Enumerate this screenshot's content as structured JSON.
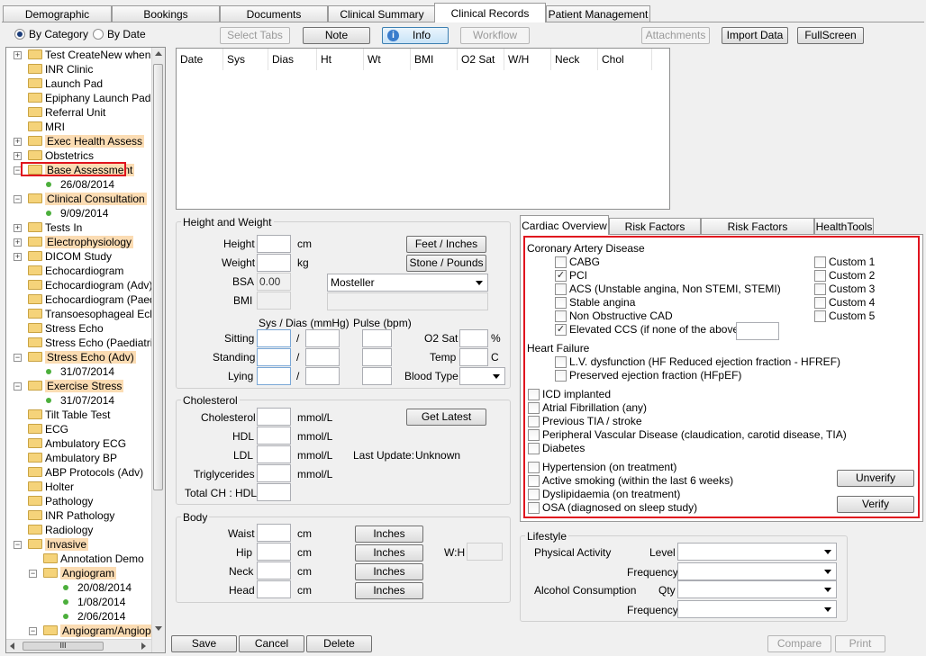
{
  "top_tabs": [
    "Demographic",
    "Bookings",
    "Documents",
    "Clinical Summary",
    "Clinical Records",
    "Patient Management"
  ],
  "view_mode": {
    "by_category": "By Category",
    "by_date": "By Date"
  },
  "toolbar": {
    "select_tabs": "Select Tabs",
    "note": "Note",
    "info": "Info",
    "workflow": "Workflow",
    "attachments": "Attachments",
    "import_data": "Import Data",
    "fullscreen": "FullScreen"
  },
  "tree": [
    {
      "label": "Test CreateNew when di",
      "level": 0,
      "expander": "+",
      "hl": false
    },
    {
      "label": "INR Clinic",
      "level": 0,
      "expander": "",
      "hl": false
    },
    {
      "label": "Launch Pad",
      "level": 0,
      "expander": "",
      "hl": false
    },
    {
      "label": "Epiphany Launch Pad",
      "level": 0,
      "expander": "",
      "hl": false
    },
    {
      "label": "Referral Unit",
      "level": 0,
      "expander": "",
      "hl": false
    },
    {
      "label": "MRI",
      "level": 0,
      "expander": "",
      "hl": false
    },
    {
      "label": "Exec Health Assess",
      "level": 0,
      "expander": "+",
      "hl": true
    },
    {
      "label": "Obstetrics",
      "level": 0,
      "expander": "+",
      "hl": false
    },
    {
      "label": "Base Assessment",
      "level": 0,
      "expander": "-",
      "hl": true,
      "outlined": true
    },
    {
      "label": "26/08/2014",
      "level": 1,
      "date": true
    },
    {
      "label": "Clinical Consultation",
      "level": 0,
      "expander": "-",
      "hl": true
    },
    {
      "label": "9/09/2014",
      "level": 1,
      "date": true
    },
    {
      "label": "Tests In",
      "level": 0,
      "expander": "+",
      "hl": false
    },
    {
      "label": "Electrophysiology",
      "level": 0,
      "expander": "+",
      "hl": true
    },
    {
      "label": "DICOM Study",
      "level": 0,
      "expander": "+",
      "hl": false
    },
    {
      "label": "Echocardiogram",
      "level": 0,
      "expander": "",
      "hl": false
    },
    {
      "label": "Echocardiogram (Adv)",
      "level": 0,
      "expander": "",
      "hl": false
    },
    {
      "label": "Echocardiogram (Paedia",
      "level": 0,
      "expander": "",
      "hl": false
    },
    {
      "label": "Transoesophageal Echo",
      "level": 0,
      "expander": "",
      "hl": false
    },
    {
      "label": "Stress Echo",
      "level": 0,
      "expander": "",
      "hl": false
    },
    {
      "label": "Stress Echo (Paediatric)",
      "level": 0,
      "expander": "",
      "hl": false
    },
    {
      "label": "Stress Echo (Adv)",
      "level": 0,
      "expander": "-",
      "hl": true
    },
    {
      "label": "31/07/2014",
      "level": 1,
      "date": true
    },
    {
      "label": "Exercise Stress",
      "level": 0,
      "expander": "-",
      "hl": true
    },
    {
      "label": "31/07/2014",
      "level": 1,
      "date": true
    },
    {
      "label": "Tilt Table Test",
      "level": 0,
      "expander": "",
      "hl": false
    },
    {
      "label": "ECG",
      "level": 0,
      "expander": "",
      "hl": false
    },
    {
      "label": "Ambulatory ECG",
      "level": 0,
      "expander": "",
      "hl": false
    },
    {
      "label": "Ambulatory BP",
      "level": 0,
      "expander": "",
      "hl": false
    },
    {
      "label": "ABP Protocols (Adv)",
      "level": 0,
      "expander": "",
      "hl": false
    },
    {
      "label": "Holter",
      "level": 0,
      "expander": "",
      "hl": false
    },
    {
      "label": "Pathology",
      "level": 0,
      "expander": "",
      "hl": false
    },
    {
      "label": "INR Pathology",
      "level": 0,
      "expander": "",
      "hl": false
    },
    {
      "label": "Radiology",
      "level": 0,
      "expander": "",
      "hl": false
    },
    {
      "label": "Invasive",
      "level": 0,
      "expander": "-",
      "hl": true
    },
    {
      "label": "Annotation Demo",
      "level": 1,
      "expander": "",
      "hl": false
    },
    {
      "label": "Angiogram",
      "level": 1,
      "expander": "-",
      "hl": true
    },
    {
      "label": "20/08/2014",
      "level": 2,
      "date": true
    },
    {
      "label": "1/08/2014",
      "level": 2,
      "date": true
    },
    {
      "label": "2/06/2014",
      "level": 2,
      "date": true
    },
    {
      "label": "Angiogram/Angioplas",
      "level": 1,
      "expander": "-",
      "hl": true
    }
  ],
  "grid_columns": [
    "Date",
    "Sys",
    "Dias",
    "Ht",
    "Wt",
    "BMI",
    "O2 Sat",
    "W/H",
    "Neck",
    "Chol"
  ],
  "height_weight": {
    "title": "Height and Weight",
    "height": "Height",
    "height_unit": "cm",
    "weight": "Weight",
    "weight_unit": "kg",
    "bsa": "BSA",
    "bsa_value": "0.00",
    "bmi": "BMI",
    "feet_inches": "Feet / Inches",
    "stone_pounds": "Stone / Pounds",
    "formula": "Mosteller",
    "sys_dias": "Sys / Dias (mmHg)",
    "pulse": "Pulse (bpm)",
    "sitting": "Sitting",
    "standing": "Standing",
    "lying": "Lying",
    "slash": "/",
    "o2sat": "O2 Sat",
    "pct": "%",
    "temp": "Temp",
    "temp_unit": "C",
    "blood_type": "Blood Type"
  },
  "cholesterol": {
    "title": "Cholesterol",
    "cholesterol": "Cholesterol",
    "hdl": "HDL",
    "ldl": "LDL",
    "triglycerides": "Triglycerides",
    "total_hdl": "Total CH : HDL",
    "unit": "mmol/L",
    "get_latest": "Get Latest",
    "last_update": "Last Update:",
    "last_update_value": "Unknown"
  },
  "body": {
    "title": "Body",
    "waist": "Waist",
    "hip": "Hip",
    "neck": "Neck",
    "head": "Head",
    "unit": "cm",
    "inches": "Inches",
    "wh": "W:H"
  },
  "cardiac_tabs": [
    "Cardiac Overview",
    "Risk Factors (Adult)",
    "Risk Factors (Paediatric)",
    "HealthTools"
  ],
  "cad": {
    "title": "Coronary Artery Disease",
    "items": [
      {
        "label": "CABG",
        "checked": false
      },
      {
        "label": "PCI",
        "checked": true
      },
      {
        "label": "ACS (Unstable angina, Non STEMI, STEMI)",
        "checked": false
      },
      {
        "label": "Stable angina",
        "checked": false
      },
      {
        "label": "Non Obstructive CAD",
        "checked": false
      },
      {
        "label": "Elevated CCS (if none of the above)",
        "checked": true
      }
    ],
    "custom": [
      "Custom 1",
      "Custom 2",
      "Custom 3",
      "Custom 4",
      "Custom 5"
    ]
  },
  "heart_failure": {
    "title": "Heart Failure",
    "items": [
      "L.V. dysfunction (HF Reduced ejection fraction - HFREF)",
      "Preserved ejection fraction (HFpEF)"
    ]
  },
  "conditions": [
    "ICD implanted",
    "Atrial Fibrillation (any)",
    "Previous TIA / stroke",
    "Peripheral Vascular Disease (claudication, carotid disease, TIA)",
    "Diabetes"
  ],
  "risk_items": [
    "Hypertension (on treatment)",
    "Active smoking (within the last 6 weeks)",
    "Dyslipidaemia (on treatment)",
    "OSA (diagnosed on sleep study)"
  ],
  "verify": {
    "unverify": "Unverify",
    "verify": "Verify"
  },
  "lifestyle": {
    "title": "Lifestyle",
    "physical": "Physical Activity",
    "level": "Level",
    "frequency": "Frequency",
    "alcohol": "Alcohol Consumption",
    "qty": "Qty"
  },
  "bottom": {
    "save": "Save",
    "cancel": "Cancel",
    "delete": "Delete",
    "compare": "Compare",
    "print": "Print"
  },
  "scroll_h_glyph": "III"
}
